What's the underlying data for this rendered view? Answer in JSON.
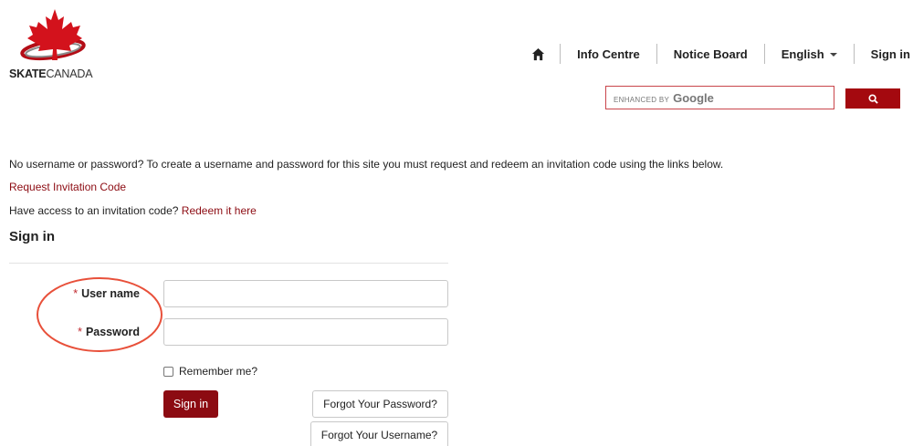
{
  "header": {
    "logo": {
      "brand_bold": "SKATE",
      "brand_light": "CANADA"
    },
    "nav": [
      {
        "label": "Info Centre"
      },
      {
        "label": "Notice Board"
      },
      {
        "label": "English"
      },
      {
        "label": "Sign in"
      }
    ],
    "search": {
      "watermark_prefix": "ENHANCED BY",
      "watermark_brand": "Google"
    }
  },
  "content": {
    "intro_text": "No username or password? To create a username and password for this site you must request and redeem an invitation code using the links below.",
    "request_link": "Request Invitation Code",
    "have_access_text": "Have access to an invitation code? ",
    "redeem_link": "Redeem it here",
    "signin_heading": "Sign in"
  },
  "form": {
    "required_mark": "*",
    "username_label": "User name",
    "password_label": "Password",
    "username_value": "",
    "password_value": "",
    "remember_label": "Remember me?",
    "remember_checked": false,
    "signin_button": "Sign in",
    "forgot_password_button": "Forgot Your Password?",
    "forgot_username_button": "Forgot Your Username?"
  },
  "colors": {
    "brand_red": "#8c0b12",
    "search_button": "#a4090f",
    "annotation_circle": "#e8503a",
    "required_star": "#c0272d"
  },
  "icons": {
    "home": "home-icon",
    "search": "search-icon",
    "caret": "caret-down-icon",
    "logo": "maple-leaf-logo-icon"
  }
}
